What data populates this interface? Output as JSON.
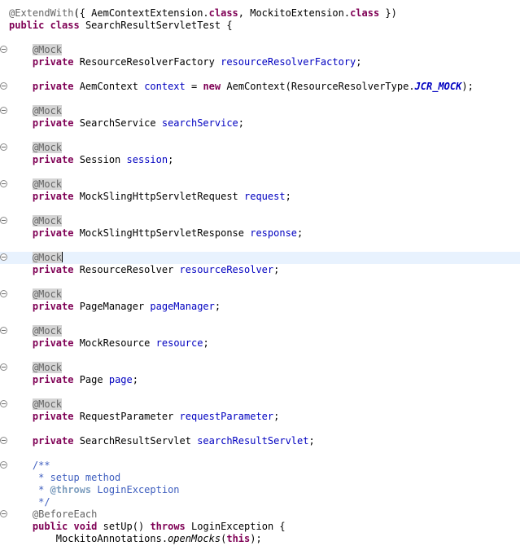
{
  "editor": {
    "lines": [
      [
        {
          "t": "ann",
          "v": "@ExtendWith"
        },
        {
          "t": "txt",
          "v": "({ AemContextExtension."
        },
        {
          "t": "kw",
          "v": "class"
        },
        {
          "t": "txt",
          "v": ", MockitoExtension."
        },
        {
          "t": "kw",
          "v": "class"
        },
        {
          "t": "txt",
          "v": " })"
        }
      ],
      [
        {
          "t": "kw",
          "v": "public"
        },
        {
          "t": "txt",
          "v": " "
        },
        {
          "t": "kw",
          "v": "class"
        },
        {
          "t": "txt",
          "v": " SearchResultServletTest {"
        }
      ],
      [],
      [
        {
          "t": "txt",
          "v": "    "
        },
        {
          "t": "annhl",
          "v": "@Mock"
        }
      ],
      [
        {
          "t": "txt",
          "v": "    "
        },
        {
          "t": "kw",
          "v": "private"
        },
        {
          "t": "txt",
          "v": " ResourceResolverFactory "
        },
        {
          "t": "fld",
          "v": "resourceResolverFactory"
        },
        {
          "t": "txt",
          "v": ";"
        }
      ],
      [],
      [
        {
          "t": "txt",
          "v": "    "
        },
        {
          "t": "kw",
          "v": "private"
        },
        {
          "t": "txt",
          "v": " AemContext "
        },
        {
          "t": "fld",
          "v": "context"
        },
        {
          "t": "txt",
          "v": " = "
        },
        {
          "t": "kw",
          "v": "new"
        },
        {
          "t": "txt",
          "v": " AemContext(ResourceResolverType."
        },
        {
          "t": "sfld",
          "v": "JCR_MOCK"
        },
        {
          "t": "txt",
          "v": ");"
        }
      ],
      [],
      [
        {
          "t": "txt",
          "v": "    "
        },
        {
          "t": "annhl",
          "v": "@Mock"
        }
      ],
      [
        {
          "t": "txt",
          "v": "    "
        },
        {
          "t": "kw",
          "v": "private"
        },
        {
          "t": "txt",
          "v": " SearchService "
        },
        {
          "t": "fld",
          "v": "searchService"
        },
        {
          "t": "txt",
          "v": ";"
        }
      ],
      [],
      [
        {
          "t": "txt",
          "v": "    "
        },
        {
          "t": "annhl",
          "v": "@Mock"
        }
      ],
      [
        {
          "t": "txt",
          "v": "    "
        },
        {
          "t": "kw",
          "v": "private"
        },
        {
          "t": "txt",
          "v": " Session "
        },
        {
          "t": "fld",
          "v": "session"
        },
        {
          "t": "txt",
          "v": ";"
        }
      ],
      [],
      [
        {
          "t": "txt",
          "v": "    "
        },
        {
          "t": "annhl",
          "v": "@Mock"
        }
      ],
      [
        {
          "t": "txt",
          "v": "    "
        },
        {
          "t": "kw",
          "v": "private"
        },
        {
          "t": "txt",
          "v": " MockSlingHttpServletRequest "
        },
        {
          "t": "fld",
          "v": "request"
        },
        {
          "t": "txt",
          "v": ";"
        }
      ],
      [],
      [
        {
          "t": "txt",
          "v": "    "
        },
        {
          "t": "annhl",
          "v": "@Mock"
        }
      ],
      [
        {
          "t": "txt",
          "v": "    "
        },
        {
          "t": "kw",
          "v": "private"
        },
        {
          "t": "txt",
          "v": " MockSlingHttpServletResponse "
        },
        {
          "t": "fld",
          "v": "response"
        },
        {
          "t": "txt",
          "v": ";"
        }
      ],
      [],
      [
        {
          "t": "txt",
          "v": "    "
        },
        {
          "t": "annhl",
          "v": "@Mock"
        },
        {
          "t": "caret",
          "v": ""
        }
      ],
      [
        {
          "t": "txt",
          "v": "    "
        },
        {
          "t": "kw",
          "v": "private"
        },
        {
          "t": "txt",
          "v": " ResourceResolver "
        },
        {
          "t": "fld",
          "v": "resourceResolver"
        },
        {
          "t": "txt",
          "v": ";"
        }
      ],
      [],
      [
        {
          "t": "txt",
          "v": "    "
        },
        {
          "t": "annhl",
          "v": "@Mock"
        }
      ],
      [
        {
          "t": "txt",
          "v": "    "
        },
        {
          "t": "kw",
          "v": "private"
        },
        {
          "t": "txt",
          "v": " PageManager "
        },
        {
          "t": "fld",
          "v": "pageManager"
        },
        {
          "t": "txt",
          "v": ";"
        }
      ],
      [],
      [
        {
          "t": "txt",
          "v": "    "
        },
        {
          "t": "annhl",
          "v": "@Mock"
        }
      ],
      [
        {
          "t": "txt",
          "v": "    "
        },
        {
          "t": "kw",
          "v": "private"
        },
        {
          "t": "txt",
          "v": " MockResource "
        },
        {
          "t": "fld",
          "v": "resource"
        },
        {
          "t": "txt",
          "v": ";"
        }
      ],
      [],
      [
        {
          "t": "txt",
          "v": "    "
        },
        {
          "t": "annhl",
          "v": "@Mock"
        }
      ],
      [
        {
          "t": "txt",
          "v": "    "
        },
        {
          "t": "kw",
          "v": "private"
        },
        {
          "t": "txt",
          "v": " Page "
        },
        {
          "t": "fld",
          "v": "page"
        },
        {
          "t": "txt",
          "v": ";"
        }
      ],
      [],
      [
        {
          "t": "txt",
          "v": "    "
        },
        {
          "t": "annhl",
          "v": "@Mock"
        }
      ],
      [
        {
          "t": "txt",
          "v": "    "
        },
        {
          "t": "kw",
          "v": "private"
        },
        {
          "t": "txt",
          "v": " RequestParameter "
        },
        {
          "t": "fld",
          "v": "requestParameter"
        },
        {
          "t": "txt",
          "v": ";"
        }
      ],
      [],
      [
        {
          "t": "txt",
          "v": "    "
        },
        {
          "t": "kw",
          "v": "private"
        },
        {
          "t": "txt",
          "v": " SearchResultServlet "
        },
        {
          "t": "fld",
          "v": "searchResultServlet"
        },
        {
          "t": "txt",
          "v": ";"
        }
      ],
      [],
      [
        {
          "t": "txt",
          "v": "    "
        },
        {
          "t": "cm",
          "v": "/**"
        }
      ],
      [
        {
          "t": "txt",
          "v": "     "
        },
        {
          "t": "cm",
          "v": "* setup method"
        }
      ],
      [
        {
          "t": "txt",
          "v": "     "
        },
        {
          "t": "cm",
          "v": "* "
        },
        {
          "t": "tag",
          "v": "@throws"
        },
        {
          "t": "cm",
          "v": " LoginException"
        }
      ],
      [
        {
          "t": "txt",
          "v": "     "
        },
        {
          "t": "cm",
          "v": "*/"
        }
      ],
      [
        {
          "t": "txt",
          "v": "    "
        },
        {
          "t": "ann",
          "v": "@BeforeEach"
        }
      ],
      [
        {
          "t": "txt",
          "v": "    "
        },
        {
          "t": "kw",
          "v": "public"
        },
        {
          "t": "txt",
          "v": " "
        },
        {
          "t": "kw",
          "v": "void"
        },
        {
          "t": "txt",
          "v": " setUp() "
        },
        {
          "t": "kw",
          "v": "throws"
        },
        {
          "t": "txt",
          "v": " LoginException {"
        }
      ],
      [
        {
          "t": "txt",
          "v": "        MockitoAnnotations."
        },
        {
          "t": "it",
          "v": "openMocks"
        },
        {
          "t": "txt",
          "v": "("
        },
        {
          "t": "kw",
          "v": "this"
        },
        {
          "t": "txt",
          "v": ");"
        }
      ]
    ],
    "fold_lines": [
      3,
      6,
      8,
      11,
      14,
      17,
      20,
      23,
      26,
      29,
      32,
      35,
      37,
      41
    ],
    "current_line": 20,
    "colors": {
      "keyword": "#7f0055",
      "annotation": "#646464",
      "field": "#0000c0",
      "comment": "#3f5fbf",
      "javadoc_tag": "#7f9fbf",
      "current_line_bg": "#e8f2fe",
      "annotation_highlight_bg": "#d4d4d4"
    }
  }
}
